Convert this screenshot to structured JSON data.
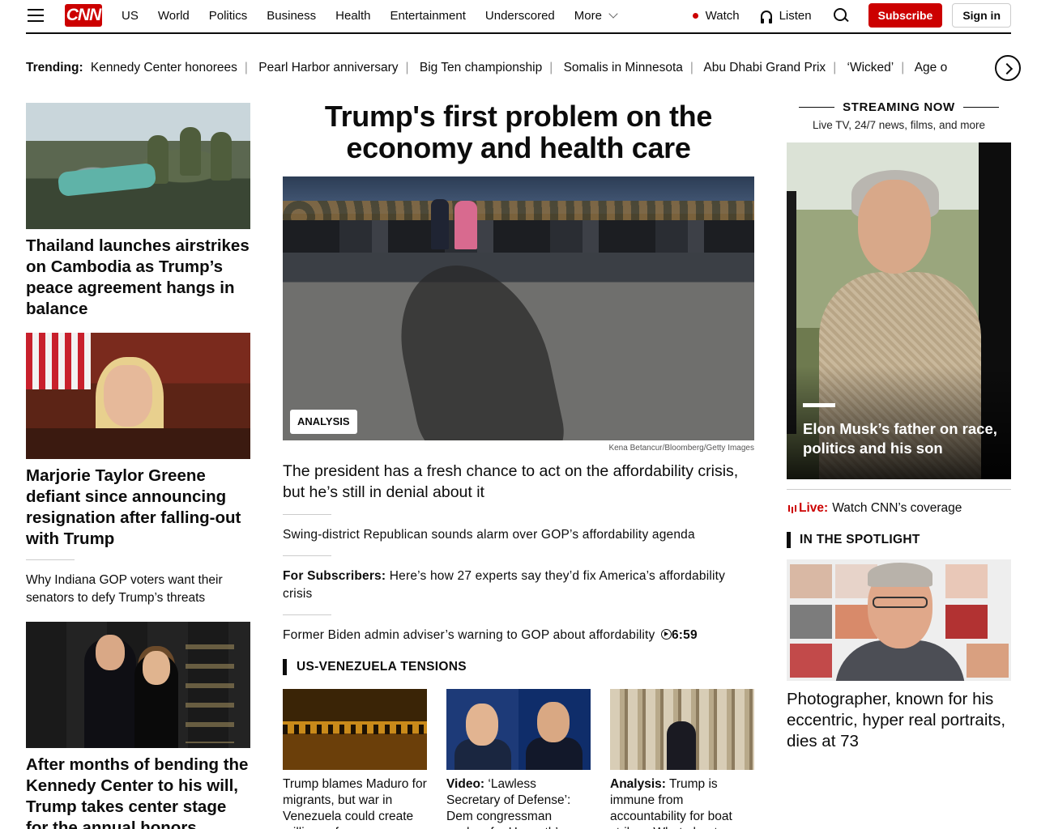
{
  "header": {
    "logo": "CNN",
    "nav": [
      "US",
      "World",
      "Politics",
      "Business",
      "Health",
      "Entertainment",
      "Underscored",
      "More"
    ],
    "watch": "Watch",
    "listen": "Listen",
    "subscribe": "Subscribe",
    "signin": "Sign in"
  },
  "trending": {
    "label": "Trending:",
    "items": [
      "Kennedy Center honorees",
      "Pearl Harbor anniversary",
      "Big Ten championship",
      "Somalis in Minnesota",
      "Abu Dhabi Grand Prix",
      "‘Wicked’",
      "Age o"
    ]
  },
  "left": {
    "story1": "Thailand launches airstrikes on Cambodia as Trump’s peace agreement hangs in balance",
    "story2": "Marjorie Taylor Greene defiant since announcing resignation after falling-out with Trump",
    "story2_sub": "Why Indiana GOP voters want their senators to defy Trump’s threats",
    "story3": "After months of bending the Kennedy Center to his will, Trump takes center stage for the annual honors"
  },
  "center": {
    "title": "Trump's first problem on the economy and health care",
    "badge": "ANALYSIS",
    "credit": "Kena Betancur/Bloomberg/Getty Images",
    "hero_desc": "The president has a fresh chance to act on the affordability crisis, but he’s still in denial about it",
    "link1": "Swing-district Republican sounds alarm over GOP’s affordability agenda",
    "link2_prefix": "For Subscribers:",
    "link2": "Here’s how 27 experts say they’d fix America’s affordability crisis",
    "link3": "Former Biden admin adviser’s warning to GOP about affordability",
    "link3_duration": "6:59",
    "section": "US-VENEZUELA TENSIONS",
    "cards": [
      {
        "prefix": "",
        "text": "Trump blames Maduro for migrants, but war in Venezuela could create millions of"
      },
      {
        "prefix": "Video:",
        "text": "‘Lawless Secretary of Defense’: Dem congressman pushes for Hegseth’s"
      },
      {
        "prefix": "Analysis:",
        "text": "Trump is immune from accountability for boat strikes. What about"
      }
    ]
  },
  "right": {
    "stream_title": "STREAMING NOW",
    "stream_sub": "Live TV, 24/7 news, films, and more",
    "stream_story": "Elon Musk’s father on race, politics and his son",
    "live_label": "Live:",
    "live_text": "Watch CNN’s coverage",
    "spotlight": "IN THE SPOTLIGHT",
    "spot_story": "Photographer, known for his eccentric, hyper real portraits, dies at 73"
  }
}
